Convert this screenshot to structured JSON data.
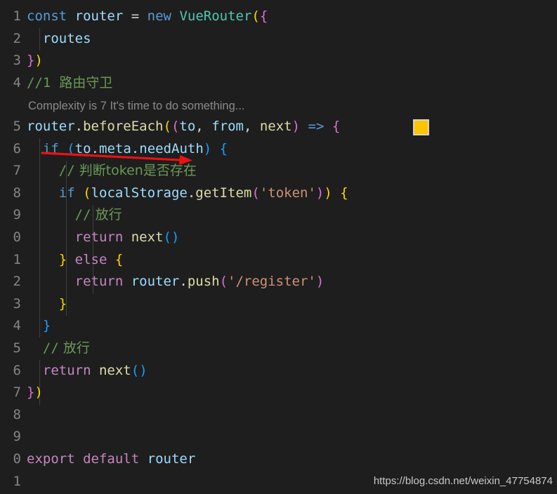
{
  "editor": {
    "theme": "dark-plus",
    "background_color": "#1e1e1e",
    "gutter_color": "#858585",
    "language": "javascript",
    "line_numbers": [
      "1",
      "2",
      "3",
      "4",
      "5",
      "6",
      "7",
      "8",
      "9",
      "0",
      "1",
      "2",
      "3",
      "4",
      "5",
      "6",
      "7",
      "8",
      "9",
      "0",
      "1"
    ],
    "codelens": {
      "text": "Complexity is 7 It's time to do something...",
      "color": "#8a8a8a",
      "attached_to_line": "5"
    },
    "marker": {
      "name": "yellow-highlight-box",
      "fill": "#ffc400",
      "border": "#d8d2c4"
    },
    "annotation": {
      "name": "red-underline-arrow",
      "color": "#ee1111",
      "targets": "(to.meta.needAuth)"
    },
    "lines": [
      {
        "num": "1",
        "indent": 0,
        "text": "const router = new VueRouter({"
      },
      {
        "num": "2",
        "indent": 1,
        "text": "  routes"
      },
      {
        "num": "3",
        "indent": 0,
        "text": "})"
      },
      {
        "num": "4",
        "indent": 0,
        "text": "//1  路由守卫"
      },
      {
        "num": "5",
        "indent": 0,
        "text": "router.beforeEach((to, from, next) => {"
      },
      {
        "num": "6",
        "indent": 1,
        "text": "  if (to.meta.needAuth) {"
      },
      {
        "num": "7",
        "indent": 2,
        "text": "    // 判断token是否存在"
      },
      {
        "num": "8",
        "indent": 2,
        "text": "    if (localStorage.getItem('token')) {"
      },
      {
        "num": "9",
        "indent": 3,
        "text": "      // 放行"
      },
      {
        "num": "0",
        "indent": 3,
        "text": "      return next()"
      },
      {
        "num": "1",
        "indent": 2,
        "text": "    } else {"
      },
      {
        "num": "2",
        "indent": 3,
        "text": "      return router.push('/register')"
      },
      {
        "num": "3",
        "indent": 2,
        "text": "    }"
      },
      {
        "num": "4",
        "indent": 1,
        "text": "  }"
      },
      {
        "num": "5",
        "indent": 1,
        "text": "  // 放行"
      },
      {
        "num": "6",
        "indent": 1,
        "text": "  return next()"
      },
      {
        "num": "7",
        "indent": 0,
        "text": "})"
      },
      {
        "num": "8",
        "indent": 0,
        "text": ""
      },
      {
        "num": "9",
        "indent": 0,
        "text": ""
      },
      {
        "num": "0",
        "indent": 0,
        "text": "export default router"
      },
      {
        "num": "1",
        "indent": 0,
        "text": ""
      }
    ]
  },
  "watermark": {
    "text": "https://blog.csdn.net/weixin_47754874"
  }
}
